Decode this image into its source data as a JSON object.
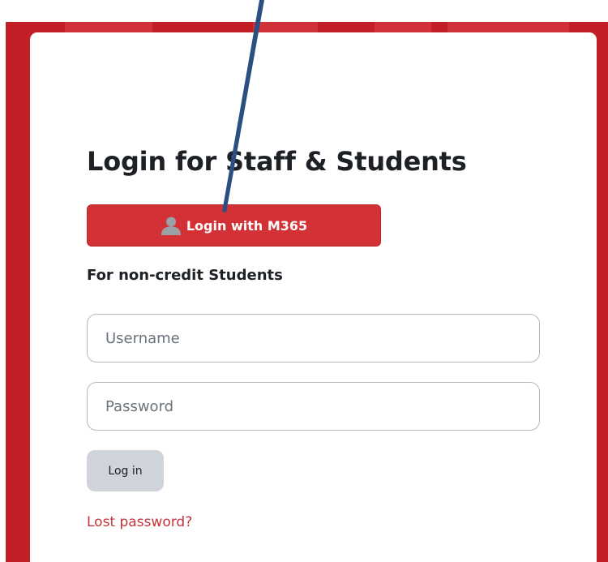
{
  "login": {
    "title": "Login for Staff & Students",
    "m365_button_label": "Login with M365",
    "m365_icon": "user-icon",
    "subheading": "For non-credit Students",
    "username_placeholder": "Username",
    "password_placeholder": "Password",
    "login_button_label": "Log in",
    "lost_password_label": "Lost password?"
  },
  "colors": {
    "background_red": "#c22026",
    "button_red": "#d23136",
    "link_red": "#c4353b",
    "login_button_gray": "#ced4da",
    "annotation_arrow": "#2b4f82"
  }
}
